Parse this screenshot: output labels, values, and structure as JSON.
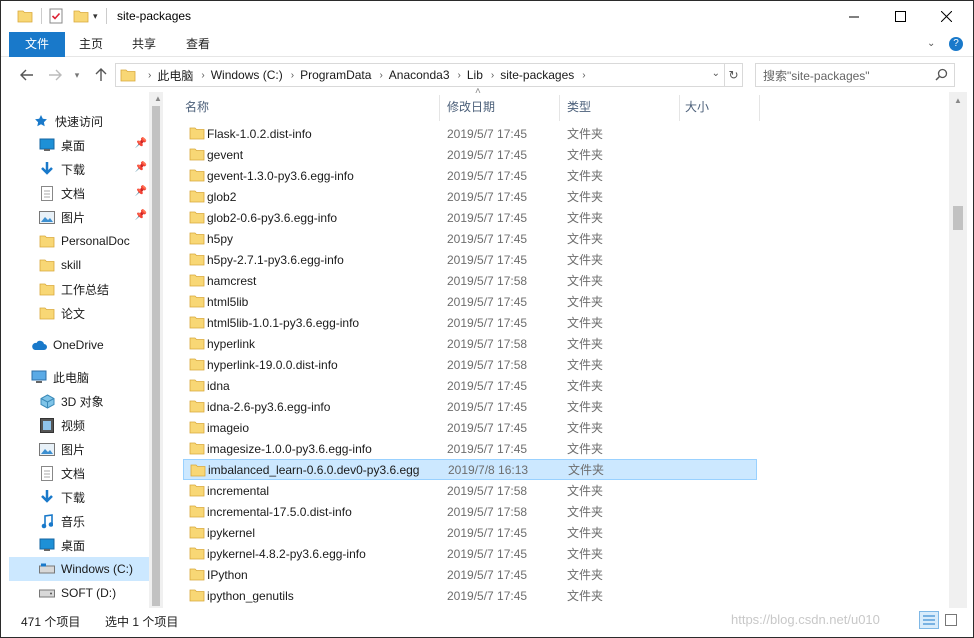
{
  "window": {
    "title": "site-packages",
    "controls": [
      "minimize-icon",
      "maximize-icon",
      "close-icon"
    ]
  },
  "ribbon": {
    "tabs": [
      {
        "label": "文件",
        "active": true
      },
      {
        "label": "主页"
      },
      {
        "label": "共享"
      },
      {
        "label": "查看"
      }
    ]
  },
  "address": {
    "crumbs": [
      "此电脑",
      "Windows (C:)",
      "ProgramData",
      "Anaconda3",
      "Lib",
      "site-packages"
    ]
  },
  "search": {
    "placeholder": "搜索\"site-packages\""
  },
  "sidebar": {
    "items": [
      {
        "label": "快速访问",
        "icon": "star-icon",
        "pinned": false
      },
      {
        "label": "桌面",
        "icon": "desktop-icon",
        "pinned": true
      },
      {
        "label": "下载",
        "icon": "download-icon",
        "pinned": true
      },
      {
        "label": "文档",
        "icon": "document-icon",
        "pinned": true
      },
      {
        "label": "图片",
        "icon": "picture-icon",
        "pinned": true
      },
      {
        "label": "PersonalDoc",
        "icon": "folder-icon"
      },
      {
        "label": "skill",
        "icon": "folder-icon"
      },
      {
        "label": "工作总结",
        "icon": "folder-icon"
      },
      {
        "label": "论文",
        "icon": "folder-icon"
      },
      {
        "label": "OneDrive",
        "icon": "cloud-icon"
      },
      {
        "label": "此电脑",
        "icon": "computer-icon"
      },
      {
        "label": "3D 对象",
        "icon": "cube-icon"
      },
      {
        "label": "视频",
        "icon": "video-icon"
      },
      {
        "label": "图片",
        "icon": "picture-icon"
      },
      {
        "label": "文档",
        "icon": "document-icon"
      },
      {
        "label": "下载",
        "icon": "download-icon"
      },
      {
        "label": "音乐",
        "icon": "music-icon"
      },
      {
        "label": "桌面",
        "icon": "desktop-icon"
      },
      {
        "label": "Windows (C:)",
        "icon": "drive-icon",
        "selected": true
      },
      {
        "label": "SOFT (D:)",
        "icon": "drive-icon"
      }
    ]
  },
  "columns": {
    "name": "名称",
    "date": "修改日期",
    "type": "类型",
    "size": "大小"
  },
  "files": [
    {
      "name": "Flask-1.0.2.dist-info",
      "date": "2019/5/7 17:45",
      "type": "文件夹"
    },
    {
      "name": "gevent",
      "date": "2019/5/7 17:45",
      "type": "文件夹"
    },
    {
      "name": "gevent-1.3.0-py3.6.egg-info",
      "date": "2019/5/7 17:45",
      "type": "文件夹"
    },
    {
      "name": "glob2",
      "date": "2019/5/7 17:45",
      "type": "文件夹"
    },
    {
      "name": "glob2-0.6-py3.6.egg-info",
      "date": "2019/5/7 17:45",
      "type": "文件夹"
    },
    {
      "name": "h5py",
      "date": "2019/5/7 17:45",
      "type": "文件夹"
    },
    {
      "name": "h5py-2.7.1-py3.6.egg-info",
      "date": "2019/5/7 17:45",
      "type": "文件夹"
    },
    {
      "name": "hamcrest",
      "date": "2019/5/7 17:58",
      "type": "文件夹"
    },
    {
      "name": "html5lib",
      "date": "2019/5/7 17:45",
      "type": "文件夹"
    },
    {
      "name": "html5lib-1.0.1-py3.6.egg-info",
      "date": "2019/5/7 17:45",
      "type": "文件夹"
    },
    {
      "name": "hyperlink",
      "date": "2019/5/7 17:58",
      "type": "文件夹"
    },
    {
      "name": "hyperlink-19.0.0.dist-info",
      "date": "2019/5/7 17:58",
      "type": "文件夹"
    },
    {
      "name": "idna",
      "date": "2019/5/7 17:45",
      "type": "文件夹"
    },
    {
      "name": "idna-2.6-py3.6.egg-info",
      "date": "2019/5/7 17:45",
      "type": "文件夹"
    },
    {
      "name": "imageio",
      "date": "2019/5/7 17:45",
      "type": "文件夹"
    },
    {
      "name": "imagesize-1.0.0-py3.6.egg-info",
      "date": "2019/5/7 17:45",
      "type": "文件夹"
    },
    {
      "name": "imbalanced_learn-0.6.0.dev0-py3.6.egg",
      "date": "2019/7/8 16:13",
      "type": "文件夹",
      "selected": true
    },
    {
      "name": "incremental",
      "date": "2019/5/7 17:58",
      "type": "文件夹"
    },
    {
      "name": "incremental-17.5.0.dist-info",
      "date": "2019/5/7 17:58",
      "type": "文件夹"
    },
    {
      "name": "ipykernel",
      "date": "2019/5/7 17:45",
      "type": "文件夹"
    },
    {
      "name": "ipykernel-4.8.2-py3.6.egg-info",
      "date": "2019/5/7 17:45",
      "type": "文件夹"
    },
    {
      "name": "IPython",
      "date": "2019/5/7 17:45",
      "type": "文件夹"
    },
    {
      "name": "ipython_genutils",
      "date": "2019/5/7 17:45",
      "type": "文件夹"
    }
  ],
  "status": {
    "count": "471 个项目",
    "selected": "选中 1 个项目"
  },
  "watermark": "https://blog.csdn.net/u010",
  "colors": {
    "accent": "#1979ca",
    "selection": "#cce8ff",
    "folder": "#f8d775"
  }
}
